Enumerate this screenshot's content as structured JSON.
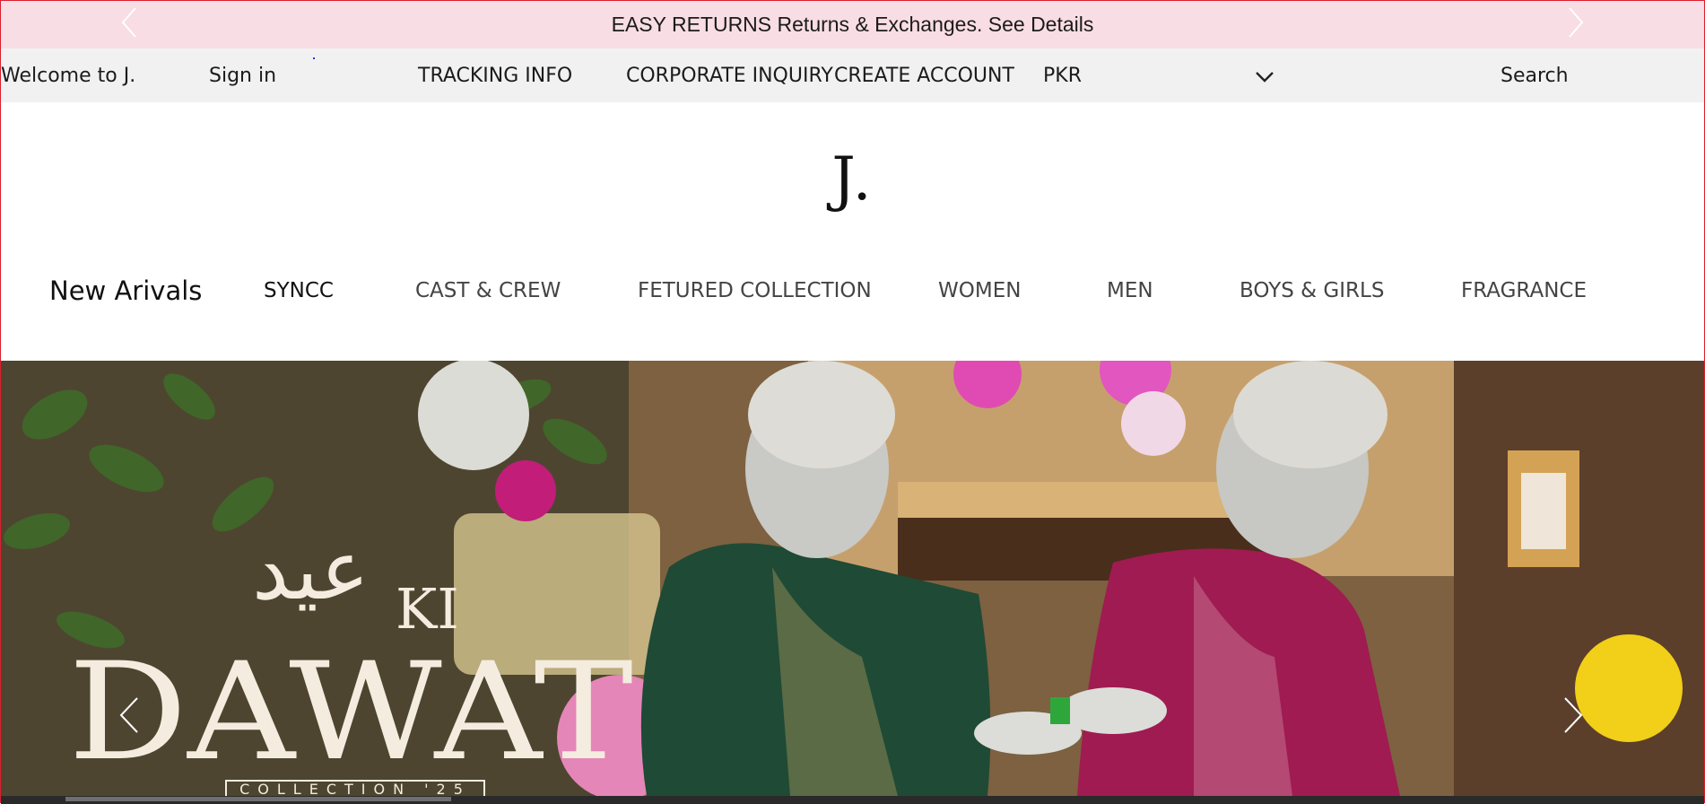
{
  "announcement": {
    "text": "EASY RETURNS Returns & Exchanges. See Details",
    "prev_icon": "chevron-left-icon",
    "next_icon": "chevron-right-icon"
  },
  "utility": {
    "welcome": "Welcome to J.",
    "sign_in": "Sign in",
    "tracking": "TRACKING INFO",
    "corporate": "CORPORATE INQUIRY",
    "create_account": "CREATE ACCOUNT",
    "currency": "PKR",
    "currency_icon": "chevron-down-icon",
    "search": "Search"
  },
  "logo": {
    "text": "J."
  },
  "nav": {
    "items": [
      {
        "label": "New Arivals"
      },
      {
        "label": "SYNCC"
      },
      {
        "label": "CAST & CREW"
      },
      {
        "label": "FETURED COLLECTION"
      },
      {
        "label": "WOMEN"
      },
      {
        "label": "MEN"
      },
      {
        "label": "BOYS & GIRLS"
      },
      {
        "label": "FRAGRANCE"
      }
    ]
  },
  "hero": {
    "title_script": "عید",
    "title_ki": "KI",
    "title_main": "DAWAT",
    "collection": "COLLECTION '25",
    "prev_icon": "chevron-left-icon",
    "next_icon": "chevron-right-icon"
  },
  "colors": {
    "announcement_bg": "#f9dde4",
    "utility_bg": "#f1f1f1",
    "green_outfit": "#1f4a35",
    "magenta_outfit": "#a01b52"
  }
}
